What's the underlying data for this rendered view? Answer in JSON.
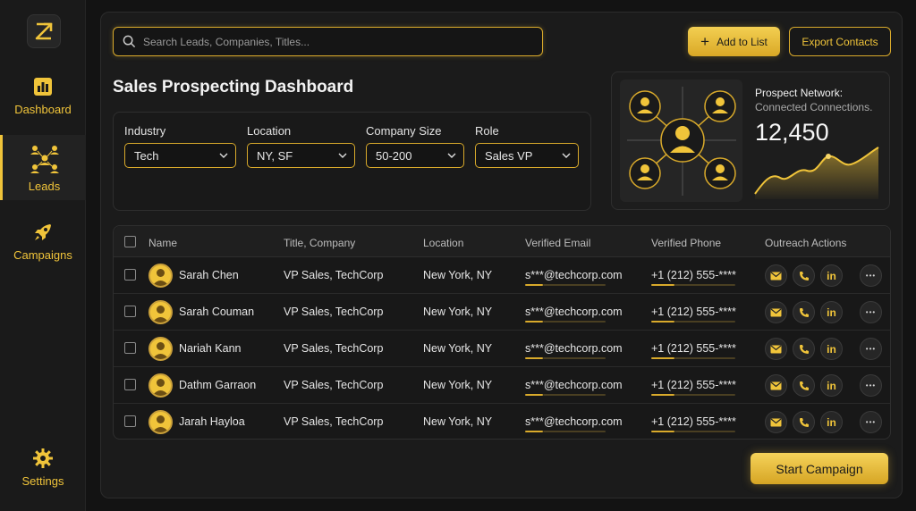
{
  "sidebar": {
    "items": [
      {
        "label": "Dashboard",
        "icon": "bar-chart-icon"
      },
      {
        "label": "Leads",
        "icon": "people-network-icon"
      },
      {
        "label": "Campaigns",
        "icon": "rocket-icon"
      },
      {
        "label": "Settings",
        "icon": "gear-icon"
      }
    ],
    "active": "Leads"
  },
  "search": {
    "placeholder": "Search Leads, Companies, Titles..."
  },
  "toolbar": {
    "add_label": "Add to List",
    "export_label": "Export Contacts"
  },
  "page_title": "Sales Prospecting Dashboard",
  "filters": [
    {
      "label": "Industry",
      "value": "Tech"
    },
    {
      "label": "Location",
      "value": "NY, SF"
    },
    {
      "label": "Company Size",
      "value": "50-200"
    },
    {
      "label": "Role",
      "value": "Sales VP"
    }
  ],
  "network": {
    "title": "Prospect Network:",
    "subtitle": "Connected Connections.",
    "count": "12,450"
  },
  "table": {
    "columns": [
      "Name",
      "Title, Company",
      "Location",
      "Verified Email",
      "Verified Phone",
      "Outreach Actions"
    ],
    "rows": [
      {
        "name": "Sarah Chen",
        "title": "VP Sales, TechCorp",
        "location": "New York, NY",
        "email": "s***@techcorp.com",
        "phone": "+1 (212) 555-****"
      },
      {
        "name": "Sarah Couman",
        "title": "VP Sales, TechCorp",
        "location": "New York, NY",
        "email": "s***@techcorp.com",
        "phone": "+1 (212) 555-****"
      },
      {
        "name": "Nariah Kann",
        "title": "VP Sales, TechCorp",
        "location": "New York, NY",
        "email": "s***@techcorp.com",
        "phone": "+1 (212) 555-****"
      },
      {
        "name": "Dathm Garraon",
        "title": "VP Sales, TechCorp",
        "location": "New York, NY",
        "email": "s***@techcorp.com",
        "phone": "+1 (212) 555-****"
      },
      {
        "name": "Jarah Hayloa",
        "title": "VP Sales, TechCorp",
        "location": "New York, NY",
        "email": "s***@techcorp.com",
        "phone": "+1 (212) 555-****"
      }
    ]
  },
  "actions": {
    "linkedin_glyph": "in",
    "more_glyph": "•••"
  },
  "campaign_button": "Start Campaign",
  "colors": {
    "accent": "#f0c43a",
    "background": "#131313",
    "panel": "#1b1b1b"
  }
}
